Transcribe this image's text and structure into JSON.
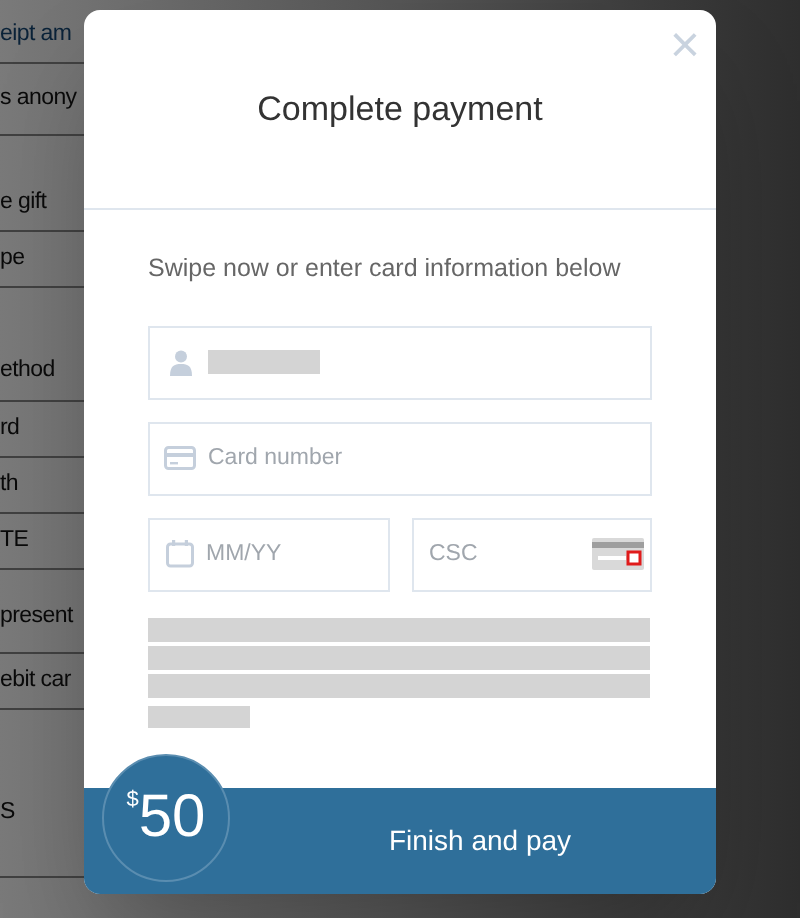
{
  "background_rows": [
    {
      "text": "eipt am",
      "kind": "link"
    },
    {
      "text": "s anony",
      "kind": "text"
    },
    {
      "text": "e gift",
      "kind": "text"
    },
    {
      "text": "pe",
      "kind": "text"
    },
    {
      "text": "ethod",
      "kind": "text"
    },
    {
      "text": "rd",
      "kind": "text"
    },
    {
      "text": "th",
      "kind": "text"
    },
    {
      "text": "TE",
      "kind": "text"
    },
    {
      "text": "present",
      "kind": "text"
    },
    {
      "text": "ebit car",
      "kind": "text"
    },
    {
      "text": "S",
      "kind": "text"
    }
  ],
  "modal": {
    "title": "Complete payment",
    "close": "×",
    "instruction": "Swipe now or enter card information below",
    "name_field": {
      "redacted": true
    },
    "card_number": {
      "placeholder": "Card number"
    },
    "expiry": {
      "placeholder": "MM/YY"
    },
    "csc": {
      "placeholder": "CSC"
    },
    "notice": {
      "redacted": true
    },
    "amount": {
      "currency": "$",
      "value": "50"
    },
    "submit": "Finish and pay"
  }
}
